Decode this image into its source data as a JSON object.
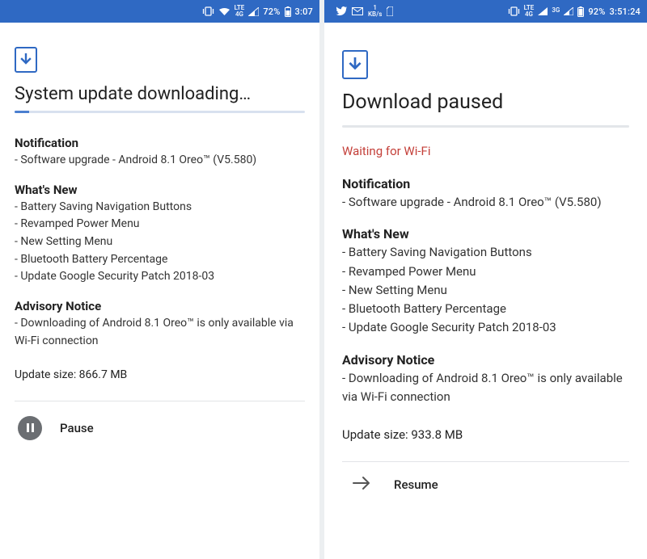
{
  "left": {
    "status": {
      "net_type": "4G",
      "net_prefix": "LTE",
      "signal_pct": "72%",
      "battery": "72%",
      "clock": "3:07"
    },
    "title": "System update downloading…",
    "sections": {
      "notification": {
        "heading": "Notification",
        "items": [
          "- Software upgrade - Android 8.1 Oreo™ (V5.580)"
        ]
      },
      "whatsnew": {
        "heading": "What's New",
        "items": [
          "- Battery Saving Navigation Buttons",
          "- Revamped Power Menu",
          "- New Setting Menu",
          "- Bluetooth Battery Percentage",
          "- Update Google Security Patch 2018-03"
        ]
      },
      "advisory": {
        "heading": "Advisory Notice",
        "items": [
          "- Downloading of Android 8.1 Oreo™ is only available via Wi-Fi connection"
        ]
      }
    },
    "update_size": "Update size: 866.7 MB",
    "action_label": "Pause"
  },
  "right": {
    "status": {
      "kbps_value": "1",
      "kbps_unit": "KB/s",
      "net_type": "3G",
      "net_prefix": "LTE",
      "net_sup": "4G",
      "battery": "92%",
      "clock": "3:51:24"
    },
    "title": "Download paused",
    "wait_msg": "Waiting for Wi-Fi",
    "sections": {
      "notification": {
        "heading": "Notification",
        "items": [
          "- Software upgrade - Android 8.1 Oreo™ (V5.580)"
        ]
      },
      "whatsnew": {
        "heading": "What's New",
        "items": [
          "- Battery Saving Navigation Buttons",
          "- Revamped Power Menu",
          "- New Setting Menu",
          "- Bluetooth Battery Percentage",
          "- Update Google Security Patch 2018-03"
        ]
      },
      "advisory": {
        "heading": "Advisory Notice",
        "items": [
          "- Downloading of Android 8.1 Oreo™ is only available via Wi-Fi connection"
        ]
      }
    },
    "update_size": "Update size: 933.8 MB",
    "action_label": "Resume"
  }
}
